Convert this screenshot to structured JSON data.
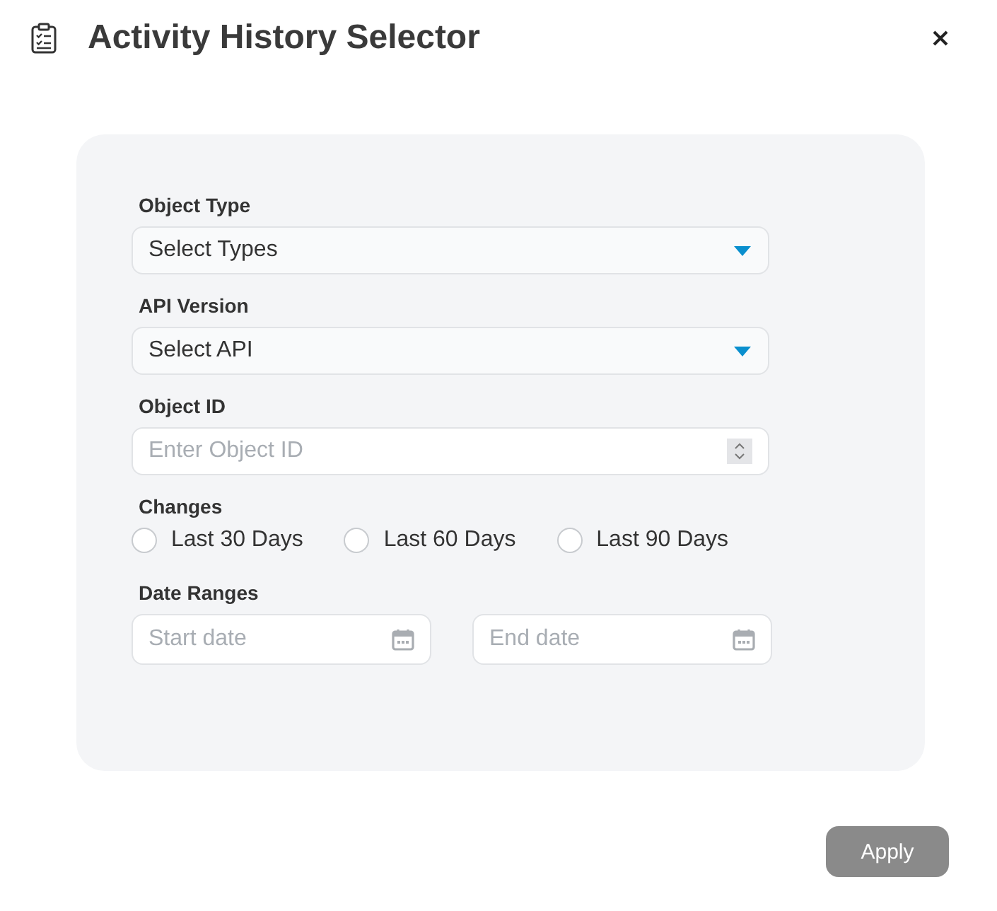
{
  "dialog": {
    "title": "Activity History Selector"
  },
  "fields": [
    {
      "kind": "select",
      "label": "Object Type",
      "value": "Select Types"
    },
    {
      "kind": "select",
      "label": "API Version",
      "value": "Select API"
    },
    {
      "kind": "number",
      "label": "Object ID",
      "placeholder": "Enter Object ID"
    }
  ],
  "changes": {
    "label": "Changes",
    "options": [
      {
        "label": "Last 30 Days",
        "selected": false
      },
      {
        "label": "Last 60 Days",
        "selected": false
      },
      {
        "label": "Last 90 Days",
        "selected": false
      }
    ]
  },
  "date_ranges": {
    "label": "Date Ranges",
    "fields": [
      {
        "placeholder": "Start date"
      },
      {
        "placeholder": "End date"
      }
    ]
  },
  "apply_button": {
    "label": "Apply",
    "disabled": true
  }
}
